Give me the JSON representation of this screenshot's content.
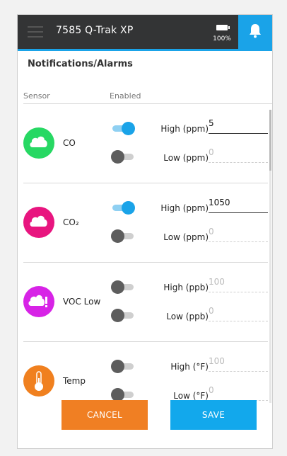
{
  "header": {
    "title": "7585 Q-Trak XP",
    "battery_label": "100%",
    "menu_icon": "hamburger-menu-icon",
    "battery_icon": "battery-icon",
    "bell_icon": "bell-icon"
  },
  "page": {
    "title": "Notifications/Alarms",
    "col_sensor": "Sensor",
    "col_enabled": "Enabled"
  },
  "colors": {
    "accent": "#1aa3e8",
    "co": "#27d863",
    "co2": "#e8157f",
    "voc": "#d723e6",
    "temp": "#f0801f",
    "cancel": "#f07f23",
    "save": "#12a8ec"
  },
  "sensors": [
    {
      "name": "CO",
      "icon": "cloud-icon",
      "color": "#27d863",
      "high_label": "High (ppm)",
      "high_value": "5",
      "high_enabled": true,
      "low_label": "Low (ppm)",
      "low_value": "0",
      "low_enabled": false
    },
    {
      "name": "CO₂",
      "icon": "cloud-icon",
      "color": "#e8157f",
      "high_label": "High (ppm)",
      "high_value": "1050",
      "high_enabled": true,
      "low_label": "Low (ppm)",
      "low_value": "0",
      "low_enabled": false
    },
    {
      "name": "VOC Low",
      "icon": "cloud-alert-icon",
      "color": "#d723e6",
      "high_label": "High (ppb)",
      "high_value": "100",
      "high_enabled": false,
      "low_label": "Low (ppb)",
      "low_value": "0",
      "low_enabled": false
    },
    {
      "name": "Temp",
      "icon": "thermometer-icon",
      "color": "#f0801f",
      "high_label": "High (°F)",
      "high_value": "100",
      "high_enabled": false,
      "low_label": "Low (°F)",
      "low_value": "0",
      "low_enabled": false
    }
  ],
  "actions": {
    "cancel": "CANCEL",
    "save": "SAVE"
  }
}
